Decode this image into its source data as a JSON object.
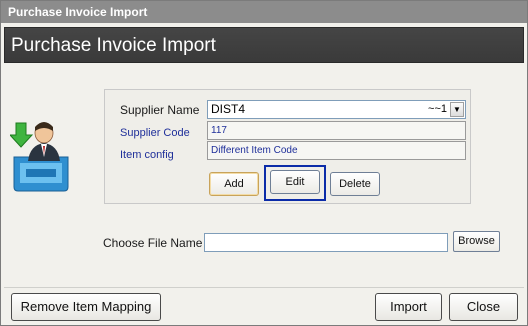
{
  "window": {
    "title": "Purchase Invoice Import"
  },
  "header": {
    "title": "Purchase Invoice Import"
  },
  "form": {
    "supplier_name_label": "Supplier Name",
    "supplier_name_value": "DIST4",
    "supplier_name_suffix": "~~1",
    "supplier_code_label": "Supplier Code",
    "supplier_code_value": "117",
    "item_config_label": "Item config",
    "item_config_value": "Different Item Code",
    "choose_file_label": "Choose File Name",
    "choose_file_value": ""
  },
  "buttons": {
    "add": "Add",
    "edit": "Edit",
    "delete": "Delete",
    "browse": "Browse",
    "remove_item_mapping": "Remove Item Mapping",
    "import": "Import",
    "close": "Close"
  },
  "icons": {
    "dropdown_arrow": "chevron-down-icon",
    "app": "user-download-icon"
  },
  "colors": {
    "header_bg": "#3f3f3f",
    "titlebar_bg": "#8c8c8c",
    "label_blue": "#1f2f9a",
    "focus_border": "#0b2ba8"
  }
}
